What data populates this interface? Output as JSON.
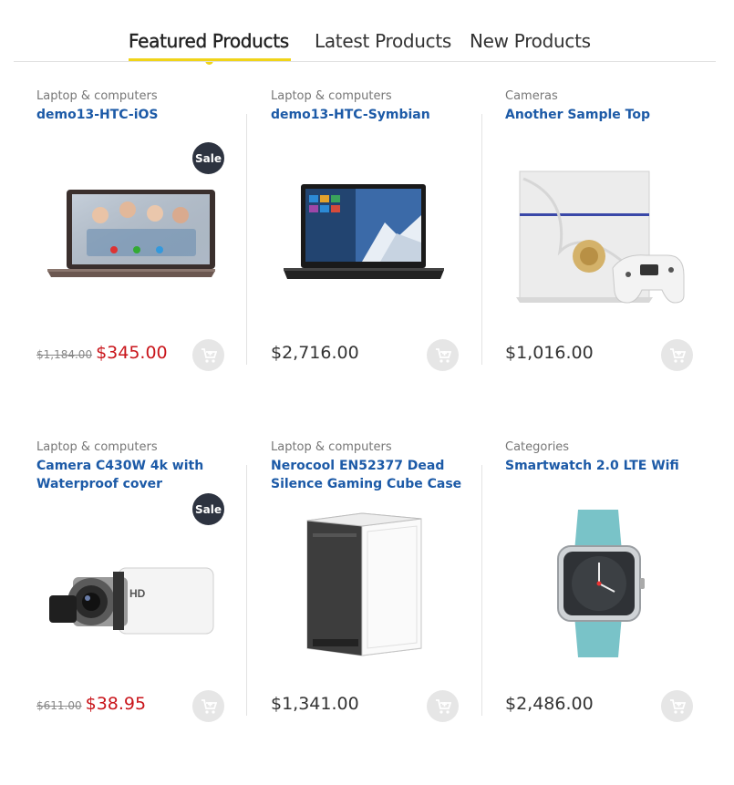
{
  "tabs": [
    {
      "label": "Featured Products",
      "active": true
    },
    {
      "label": "Latest Products",
      "active": false
    },
    {
      "label": "New Products",
      "active": false
    }
  ],
  "accent_color": "#f0d419",
  "title_color": "#1c5aa7",
  "sale_price_color": "#c9151b",
  "products": [
    {
      "category": "Laptop & computers",
      "title": "demo13-HTC-iOS",
      "badge": "Sale",
      "old_price": "$1,184.00",
      "price": "$345.00",
      "image_icon": "laptop-icon"
    },
    {
      "category": "Laptop & computers",
      "title": "demo13-HTC-Symbian",
      "badge": "",
      "old_price": "",
      "price": "$2,716.00",
      "image_icon": "laptop-icon"
    },
    {
      "category": "Cameras",
      "title": "Another Sample Top",
      "badge": "",
      "old_price": "",
      "price": "$1,016.00",
      "image_icon": "game-console-icon"
    },
    {
      "category": "Laptop & computers",
      "title": "Camera C430W 4k with Waterproof cover",
      "badge": "Sale",
      "old_price": "$611.00",
      "price": "$38.95",
      "image_icon": "camcorder-icon"
    },
    {
      "category": "Laptop & computers",
      "title": "Nerocool EN52377 Dead Silence Gaming Cube Case",
      "badge": "",
      "old_price": "",
      "price": "$1,341.00",
      "image_icon": "pc-case-icon"
    },
    {
      "category": "Categories",
      "title": "Smartwatch 2.0 LTE Wifi",
      "badge": "",
      "old_price": "",
      "price": "$2,486.00",
      "image_icon": "smartwatch-icon"
    }
  ]
}
